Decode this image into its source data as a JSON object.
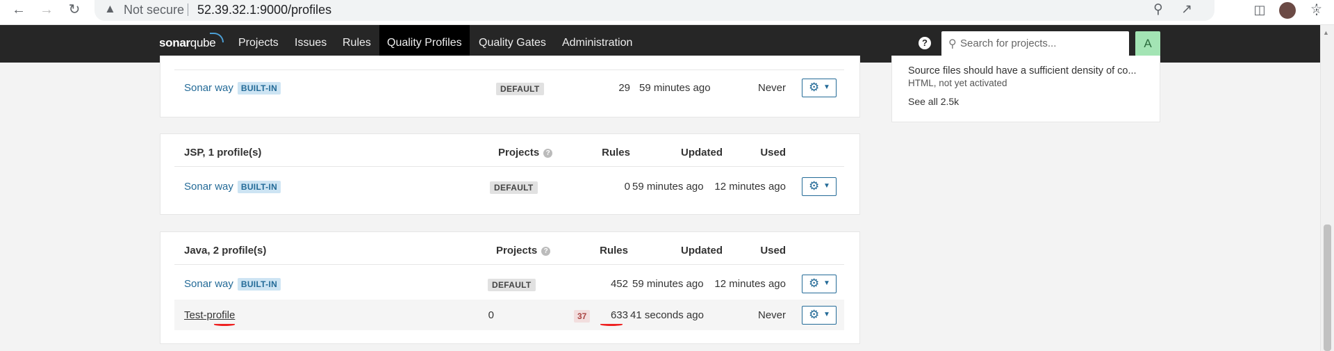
{
  "browser": {
    "security_label": "Not secure",
    "url": "52.39.32.1:9000/profiles"
  },
  "nav": {
    "logo_bold": "sonar",
    "logo_thin": "qube",
    "items": [
      {
        "label": "Projects"
      },
      {
        "label": "Issues"
      },
      {
        "label": "Rules"
      },
      {
        "label": "Quality Profiles",
        "active": true
      },
      {
        "label": "Quality Gates"
      },
      {
        "label": "Administration"
      }
    ],
    "help_symbol": "?",
    "search_placeholder": "Search for projects...",
    "avatar_letter": "A"
  },
  "sidebar": {
    "rule_link": "Source files should have a sufficient density of co...",
    "rule_status": "HTML, not yet activated",
    "see_all": "See all 2.5k"
  },
  "headers": {
    "projects": "Projects",
    "rules": "Rules",
    "updated": "Updated",
    "used": "Used",
    "info_symbol": "?"
  },
  "cards": [
    {
      "title": "",
      "rows": [
        {
          "name": "Sonar way",
          "builtin": "BUILT-IN",
          "projects": "DEFAULT",
          "rules": "29",
          "updated": "59 minutes ago",
          "used": "Never"
        }
      ]
    },
    {
      "title": "JSP, 1 profile(s)",
      "rows": [
        {
          "name": "Sonar way",
          "builtin": "BUILT-IN",
          "projects": "DEFAULT",
          "rules": "0",
          "updated": "59 minutes ago",
          "used": "12 minutes ago"
        }
      ]
    },
    {
      "title": "Java, 2 profile(s)",
      "rows": [
        {
          "name": "Sonar way",
          "builtin": "BUILT-IN",
          "projects": "DEFAULT",
          "rules": "452",
          "updated": "59 minutes ago",
          "used": "12 minutes ago"
        },
        {
          "name": "Test-profile",
          "projects": "0",
          "deprecated_rules": "37",
          "rules": "633",
          "updated": "41 seconds ago",
          "used": "Never"
        }
      ]
    }
  ],
  "colors": {
    "nav_bg": "#262626",
    "link": "#236a97",
    "builtin_badge_bg": "#cde4f3",
    "avatar_bg": "#a3e4b4",
    "annotation_red": "#e22"
  }
}
